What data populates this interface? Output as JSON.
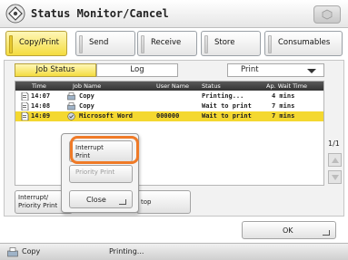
{
  "title": {
    "text": "Status Monitor/Cancel"
  },
  "tabs": [
    {
      "label": "Copy/Print",
      "active": true
    },
    {
      "label": "Send",
      "active": false
    },
    {
      "label": "Receive",
      "active": false
    },
    {
      "label": "Store",
      "active": false
    },
    {
      "label": "Consumables",
      "active": false
    }
  ],
  "subtabs": {
    "job_status": "Job Status",
    "log": "Log"
  },
  "filter": {
    "selected": "Print"
  },
  "table": {
    "headers": {
      "time": "Time",
      "job_name": "Job Name",
      "user_name": "User Name",
      "status": "Status",
      "wait": "Ap. Wait Time"
    },
    "rows": [
      {
        "time": "14:07",
        "job_name": "Copy",
        "user_name": "",
        "status": "Printing...",
        "wait": "4 mins",
        "icon": "copy-icon"
      },
      {
        "time": "14:08",
        "job_name": "Copy",
        "user_name": "",
        "status": "Wait to print",
        "wait": "7 mins",
        "icon": "copy-icon"
      },
      {
        "time": "14:09",
        "job_name": "Microsoft Word",
        "user_name": "000000",
        "status": "Wait to print",
        "wait": "7 mins",
        "icon": "print-job-icon"
      }
    ]
  },
  "pager": {
    "page": "1/1"
  },
  "buttons": {
    "interrupt_priority": [
      "Interrupt/",
      "Priority Print"
    ],
    "stop": "top",
    "ok": "OK"
  },
  "popup": {
    "interrupt_print": [
      "Interrupt",
      "Print"
    ],
    "priority_print": "Priority Print",
    "close": "Close"
  },
  "status_bar": {
    "job": "Copy",
    "message": "Printing..."
  },
  "colors": {
    "accent_yellow": "#f4dc3f",
    "highlight_orange": "#ef7a27"
  }
}
